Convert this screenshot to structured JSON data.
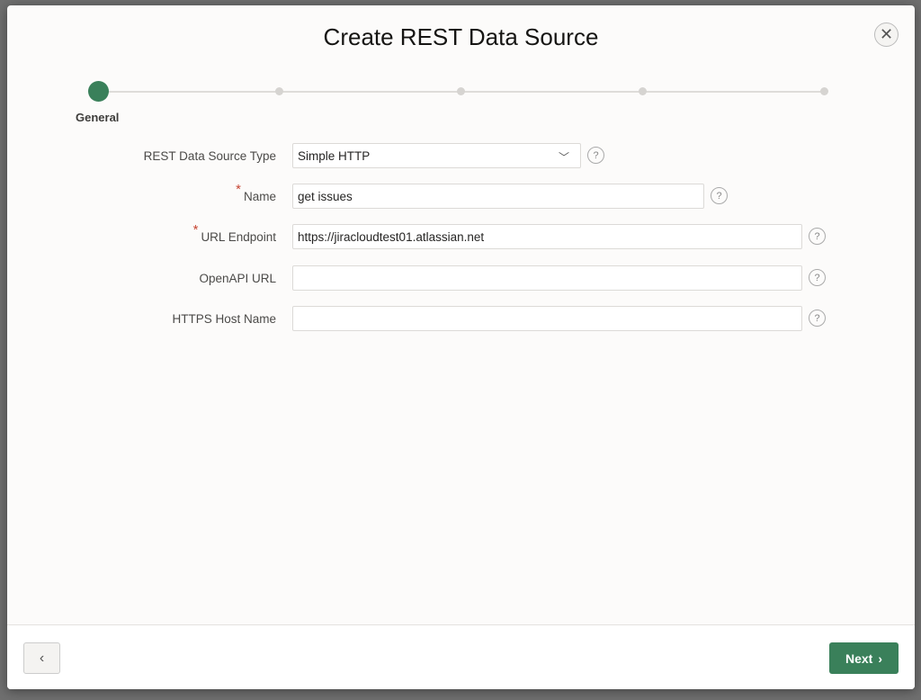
{
  "dialog": {
    "title": "Create REST Data Source",
    "close_icon": "close-icon"
  },
  "wizard": {
    "steps": [
      {
        "label": "General",
        "active": true
      },
      {
        "label": "",
        "active": false
      },
      {
        "label": "",
        "active": false
      },
      {
        "label": "",
        "active": false
      },
      {
        "label": "",
        "active": false
      }
    ],
    "accent": "#3a805a"
  },
  "form": {
    "type": {
      "label": "REST Data Source Type",
      "value": "Simple HTTP"
    },
    "name": {
      "label": "Name",
      "value": "get issues",
      "required": true
    },
    "url": {
      "label": "URL Endpoint",
      "value": "https://jiracloudtest01.atlassian.net",
      "required": true
    },
    "openapi": {
      "label": "OpenAPI URL",
      "value": ""
    },
    "https": {
      "label": "HTTPS Host Name",
      "value": ""
    },
    "help_glyph": "?",
    "required_mark": "*"
  },
  "footer": {
    "back_glyph": "‹",
    "next_label": "Next",
    "next_glyph": "›"
  }
}
